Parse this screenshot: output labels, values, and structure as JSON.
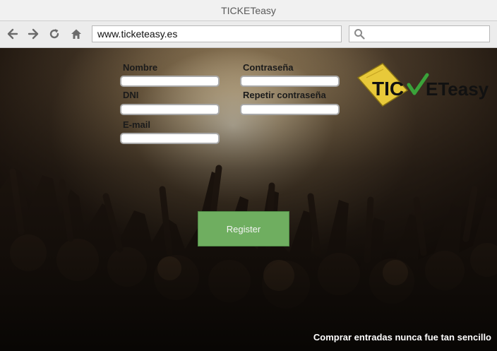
{
  "window": {
    "title": "TICKETeasy"
  },
  "toolbar": {
    "url": "www.ticketeasy.es",
    "search_placeholder": ""
  },
  "form": {
    "nombre_label": "Nombre",
    "dni_label": "DNI",
    "email_label": "E-mail",
    "contrasena_label": "Contraseña",
    "repetir_label": "Repetir contraseña",
    "register_label": "Register"
  },
  "logo": {
    "text_left": "TIC",
    "text_right": "ETeasy"
  },
  "footer": {
    "tagline": "Comprar entradas nunca fue tan sencillo"
  },
  "colors": {
    "accent": "#6fae60",
    "logo_ticket": "#e8c93a",
    "logo_check": "#3aa33a"
  }
}
